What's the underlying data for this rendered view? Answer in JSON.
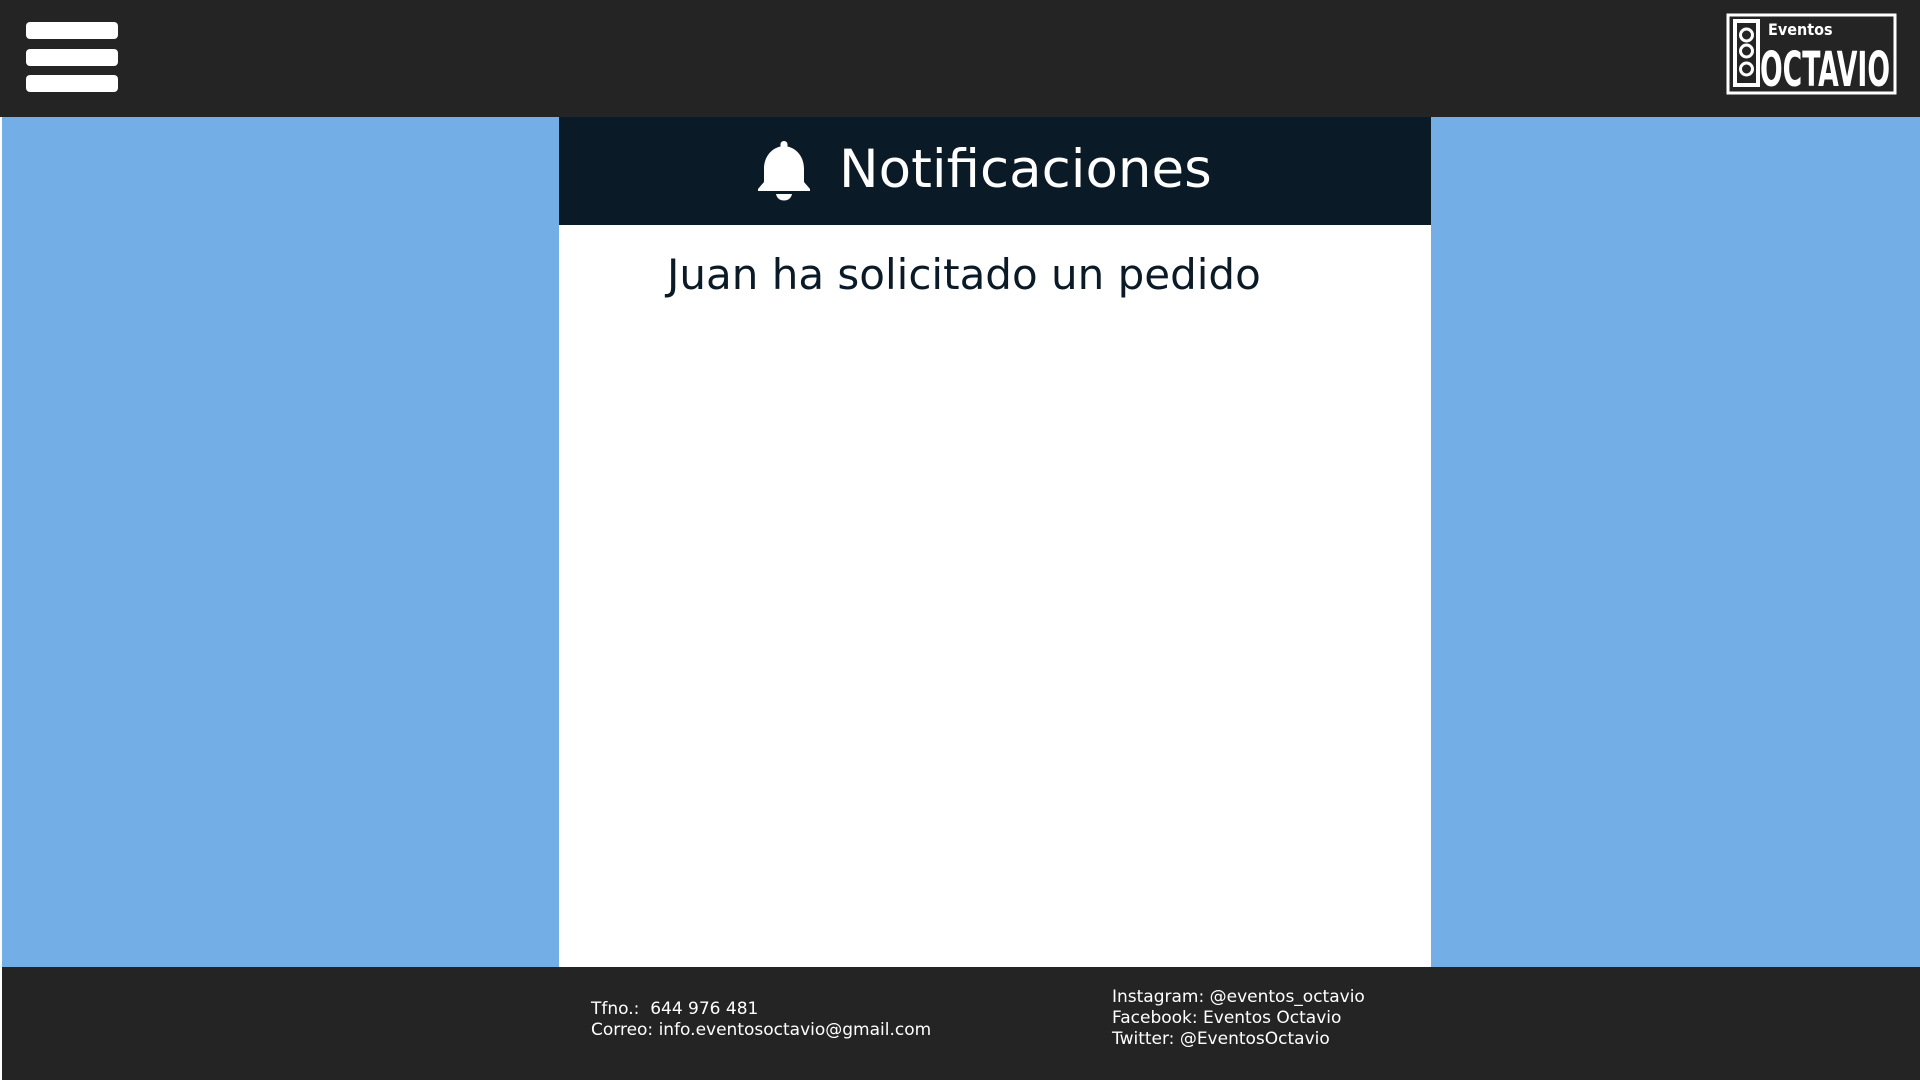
{
  "colors": {
    "topbar_bg": "#242424",
    "main_bg": "#74aee6",
    "panel_header_bg": "#0b1a27",
    "panel_bg": "#ffffff",
    "footer_bg": "#242424",
    "text_dark": "#0b1a27",
    "text_light": "#ffffff"
  },
  "header": {
    "menu_icon": "hamburger-menu-icon",
    "logo": {
      "icon": "eventos-octavio-logo",
      "small_text": "Eventos",
      "big_text": "OCTAVIO"
    }
  },
  "panel": {
    "icon": "bell-icon",
    "title": "Notificaciones",
    "notifications": [
      "Juan ha solicitado un pedido"
    ]
  },
  "footer": {
    "contact": {
      "phone_label": "Tfno.:",
      "phone": "644 976 481",
      "email_label": "Correo:",
      "email": "info.eventosoctavio@gmail.com"
    },
    "social": {
      "instagram_label": "Instagram:",
      "instagram": "@eventos_octavio",
      "facebook_label": "Facebook:",
      "facebook": "Eventos Octavio",
      "twitter_label": "Twitter:",
      "twitter": "@EventosOctavio"
    }
  }
}
